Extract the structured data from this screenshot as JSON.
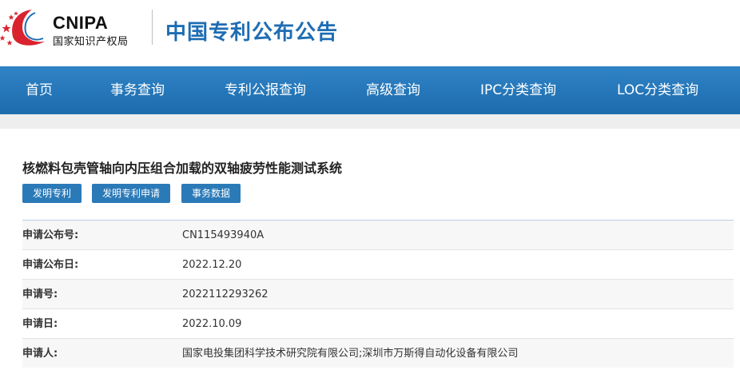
{
  "header": {
    "logo_en": "CNIPA",
    "logo_cn": "国家知识产权局",
    "site_title": "中国专利公布公告"
  },
  "nav": {
    "items": [
      "首页",
      "事务查询",
      "专利公报查询",
      "高级查询",
      "IPC分类查询",
      "LOC分类查询"
    ]
  },
  "patent": {
    "title": "核燃料包壳管轴向内压组合加载的双轴疲劳性能测试系统",
    "tags": [
      "发明专利",
      "发明专利申请",
      "事务数据"
    ],
    "fields": [
      {
        "label": "申请公布号:",
        "value": "CN115493940A"
      },
      {
        "label": "申请公布日:",
        "value": "2022.12.20"
      },
      {
        "label": "申请号:",
        "value": "2022112293262"
      },
      {
        "label": "申请日:",
        "value": "2022.10.09"
      },
      {
        "label": "申请人:",
        "value": "国家电投集团科学技术研究院有限公司;深圳市万斯得自动化设备有限公司"
      }
    ]
  },
  "colors": {
    "nav_blue": "#2472b5",
    "title_blue": "#1e6db3",
    "tag_blue": "#2b7ab8",
    "emblem_red": "#d9232e"
  }
}
